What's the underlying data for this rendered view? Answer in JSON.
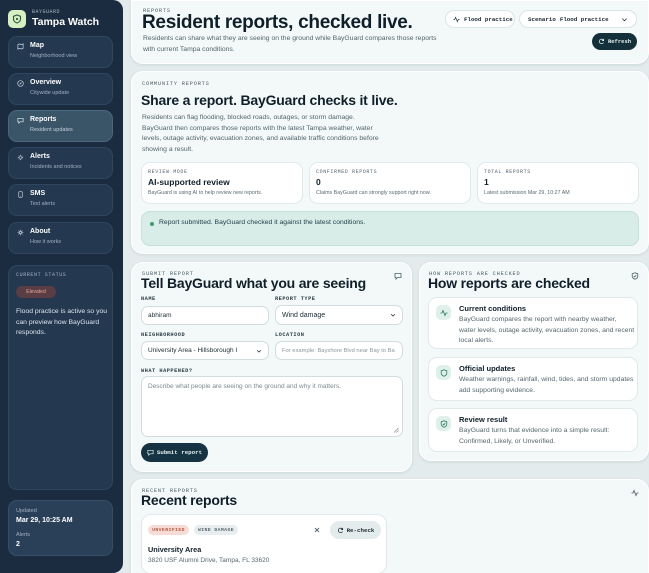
{
  "sidebar": {
    "brand_eyebrow": "BAYGUARD",
    "brand_name": "Tampa Watch",
    "nav": [
      {
        "title": "Map",
        "subtitle": "Neighborhood view",
        "icon": "map-icon"
      },
      {
        "title": "Overview",
        "subtitle": "Citywide update",
        "icon": "compass-icon"
      },
      {
        "title": "Reports",
        "subtitle": "Resident updates",
        "icon": "chat-icon"
      },
      {
        "title": "Alerts",
        "subtitle": "Incidents and notices",
        "icon": "alert-icon"
      },
      {
        "title": "SMS",
        "subtitle": "Text alerts",
        "icon": "phone-icon"
      },
      {
        "title": "About",
        "subtitle": "How it works",
        "icon": "settings-icon"
      }
    ],
    "status": {
      "eyebrow": "CURRENT STATUS",
      "pill": "Elevated",
      "text": "Flood practice is active so you can preview how BayGuard responds."
    },
    "updated": {
      "label": "Updated",
      "value": "Mar 29, 10:25 AM",
      "alerts_label": "Alerts",
      "alerts_value": "2"
    }
  },
  "header": {
    "eyebrow": "REPORTS",
    "title": "Resident reports, checked live.",
    "description": "Residents can share what they are seeing on the ground while BayGuard compares those reports with current Tampa conditions.",
    "flood_practice": "Flood practice",
    "scenario_label": "Scenario",
    "scenario_value": "Flood practice",
    "refresh": "Refresh"
  },
  "community": {
    "eyebrow": "COMMUNITY REPORTS",
    "title": "Share a report. BayGuard checks it live.",
    "description": "Residents can flag flooding, blocked roads, outages, or storm damage. BayGuard then compares those reports with the latest Tampa weather, water levels, outage activity, evacuation zones, and available traffic conditions before showing a result.",
    "stats": [
      {
        "eyebrow": "REVIEW MODE",
        "value": "AI-supported review",
        "note": "BayGuard is using AI to help review new reports."
      },
      {
        "eyebrow": "CONFIRMED REPORTS",
        "value": "0",
        "note": "Claims BayGuard can strongly support right now."
      },
      {
        "eyebrow": "TOTAL REPORTS",
        "value": "1",
        "note": "Latest submission Mar 29, 10:27 AM"
      }
    ],
    "banner": "Report submitted. BayGuard checked it against the latest conditions."
  },
  "form": {
    "eyebrow": "SUBMIT REPORT",
    "title": "Tell BayGuard what you are seeing",
    "name_label": "NAME",
    "name_value": "abhiram",
    "type_label": "REPORT TYPE",
    "type_value": "Wind damage",
    "neighborhood_label": "NEIGHBORHOOD",
    "neighborhood_value": "University Area - Hillsborough I",
    "location_label": "LOCATION",
    "location_placeholder": "For example: Bayshore Blvd near Bay to Ba",
    "what_label": "WHAT HAPPENED?",
    "what_placeholder": "Describe what people are seeing on the ground and why it matters.",
    "submit": "Submit report"
  },
  "how": {
    "eyebrow": "HOW REPORTS ARE CHECKED",
    "title": "How reports are checked",
    "cards": [
      {
        "title": "Current conditions",
        "text": "BayGuard compares the report with nearby weather, water levels, outage activity, evacuation zones, and recent local alerts.",
        "icon": "pulse-icon"
      },
      {
        "title": "Official updates",
        "text": "Weather warnings, rainfall, wind, tides, and storm updates add supporting evidence.",
        "icon": "shield-icon"
      },
      {
        "title": "Review result",
        "text": "BayGuard turns that evidence into a simple result: Confirmed, Likely, or Unverified.",
        "icon": "shield-check-icon"
      }
    ]
  },
  "recent": {
    "eyebrow": "RECENT REPORTS",
    "title": "Recent reports",
    "item": {
      "status_tag": "UNVERIFIED",
      "type_tag": "WIND DAMAGE",
      "recheck": "Re-check",
      "place": "University Area",
      "address": "3820 USF Alumni Drive, Tampa, FL 33620"
    }
  },
  "colors": {
    "sidebar": "#1b2c40",
    "accent_dark": "#153342",
    "success": "#3d9a6c",
    "warning": "#e4a79a"
  }
}
